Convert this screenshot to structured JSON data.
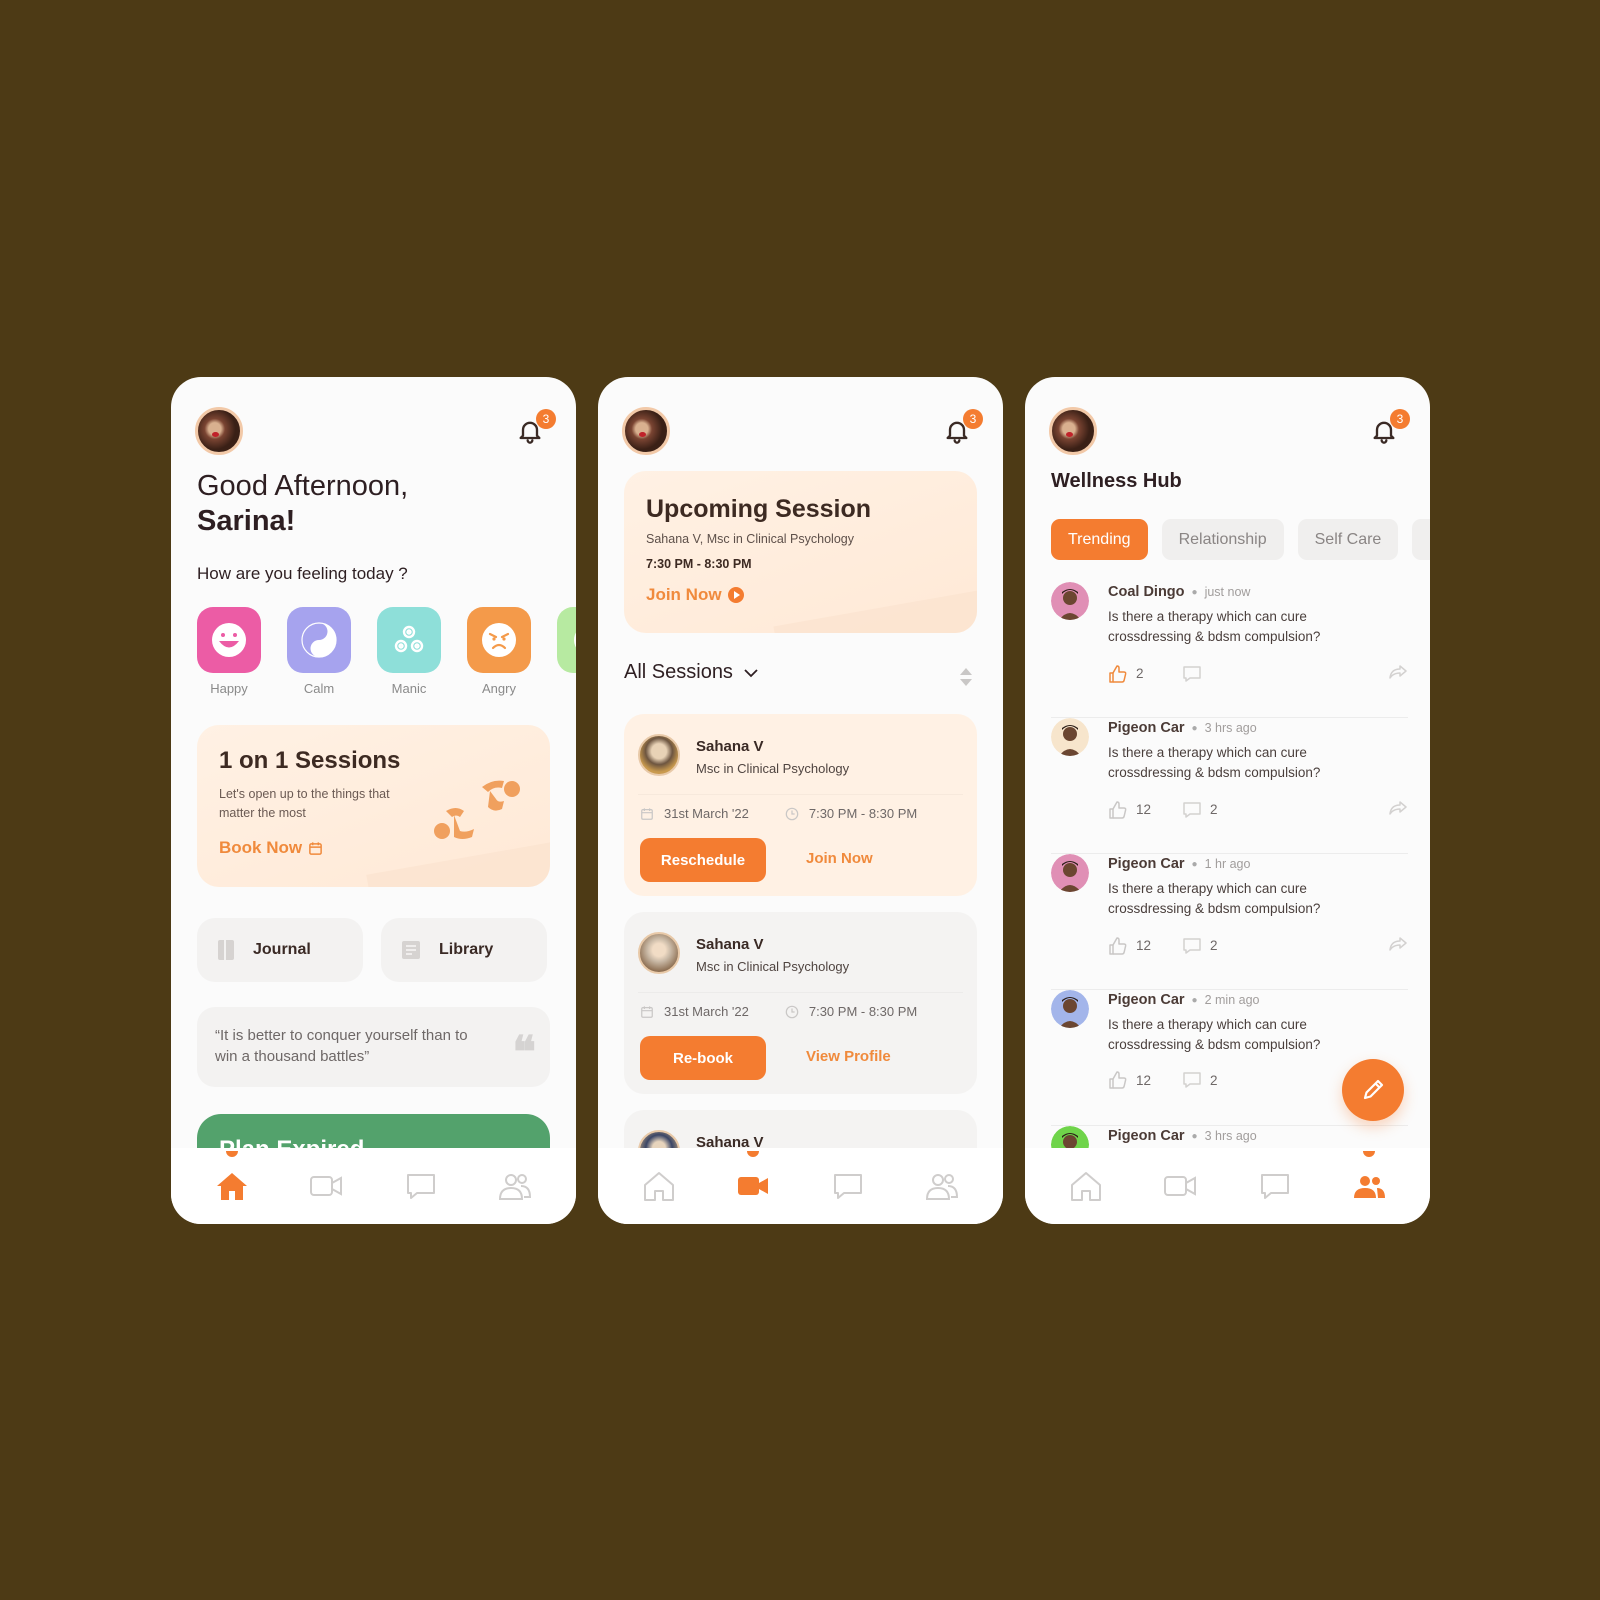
{
  "colors": {
    "background": "#4d3a15",
    "accent": "#f47c30",
    "card_warm": "#fff1e4",
    "plan_green": "#53a26c"
  },
  "common": {
    "notification_count": "3"
  },
  "home": {
    "greeting_line1": "Good Afternoon,",
    "greeting_name": "Sarina!",
    "feeling_question": "How are you feeling today ?",
    "moods": [
      {
        "label": "Happy",
        "icon": "happy-face-icon",
        "color": "#ec5ca5"
      },
      {
        "label": "Calm",
        "icon": "yin-yang-icon",
        "color": "#a6a3ee"
      },
      {
        "label": "Manic",
        "icon": "triskelion-icon",
        "color": "#8edfd9"
      },
      {
        "label": "Angry",
        "icon": "angry-face-icon",
        "color": "#f49a4a"
      },
      {
        "label": "",
        "icon": "partial-mood-icon",
        "color": "#b7eaa1"
      }
    ],
    "sessions_card": {
      "title": "1 on 1 Sessions",
      "subtitle": "Let's open up to the things that matter the most",
      "cta": "Book Now"
    },
    "quick_links": [
      {
        "label": "Journal",
        "icon": "journal-icon"
      },
      {
        "label": "Library",
        "icon": "library-icon"
      }
    ],
    "quote": "“It is better to conquer yourself than to win a thousand battles”",
    "plan_banner": "Plan Expired"
  },
  "sessions": {
    "upcoming": {
      "title": "Upcoming Session",
      "therapist": "Sahana V, Msc in Clinical Psychology",
      "time": "7:30 PM - 8:30 PM",
      "cta": "Join Now"
    },
    "filter_label": "All Sessions",
    "list": [
      {
        "name": "Sahana V",
        "credential": "Msc in Clinical Psychology",
        "date": "31st March '22",
        "time": "7:30 PM - 8:30 PM",
        "primary": "Reschedule",
        "secondary": "Join Now",
        "state": "active"
      },
      {
        "name": "Sahana V",
        "credential": "Msc in Clinical Psychology",
        "date": "31st March '22",
        "time": "7:30 PM - 8:30 PM",
        "primary": "Re-book",
        "secondary": "View Profile",
        "state": "past"
      },
      {
        "name": "Sahana V",
        "credential": "",
        "date": "",
        "time": "",
        "primary": "",
        "secondary": "",
        "state": "past"
      }
    ]
  },
  "hub": {
    "title": "Wellness Hub",
    "tabs": [
      {
        "label": "Trending",
        "active": true
      },
      {
        "label": "Relationship",
        "active": false
      },
      {
        "label": "Self Care",
        "active": false
      },
      {
        "label": "",
        "active": false
      }
    ],
    "posts": [
      {
        "author": "Coal Dingo",
        "time": "just now",
        "body": "Is there a therapy which can cure crossdressing & bdsm compulsion?",
        "likes": "2",
        "comments": "",
        "liked": true,
        "avatar_bg": "#e08fb5"
      },
      {
        "author": "Pigeon Car",
        "time": "3 hrs ago",
        "body": "Is there a therapy which can cure crossdressing & bdsm compulsion?",
        "likes": "12",
        "comments": "2",
        "liked": false,
        "avatar_bg": "#f7e5cc"
      },
      {
        "author": "Pigeon Car",
        "time": "1 hr ago",
        "body": "Is there a therapy which can cure crossdressing & bdsm compulsion?",
        "likes": "12",
        "comments": "2",
        "liked": false,
        "avatar_bg": "#e08fb5"
      },
      {
        "author": "Pigeon Car",
        "time": "2 min ago",
        "body": "Is there a therapy which can cure crossdressing & bdsm compulsion?",
        "likes": "12",
        "comments": "2",
        "liked": false,
        "avatar_bg": "#a3b5ea"
      },
      {
        "author": "Pigeon Car",
        "time": "3 hrs ago",
        "body": "",
        "likes": "",
        "comments": "",
        "liked": false,
        "avatar_bg": "#6fd44a"
      }
    ]
  },
  "nav": {
    "items": [
      {
        "name": "home",
        "icon": "home-icon"
      },
      {
        "name": "sessions",
        "icon": "video-icon"
      },
      {
        "name": "chat",
        "icon": "chat-icon"
      },
      {
        "name": "community",
        "icon": "community-icon"
      }
    ]
  }
}
